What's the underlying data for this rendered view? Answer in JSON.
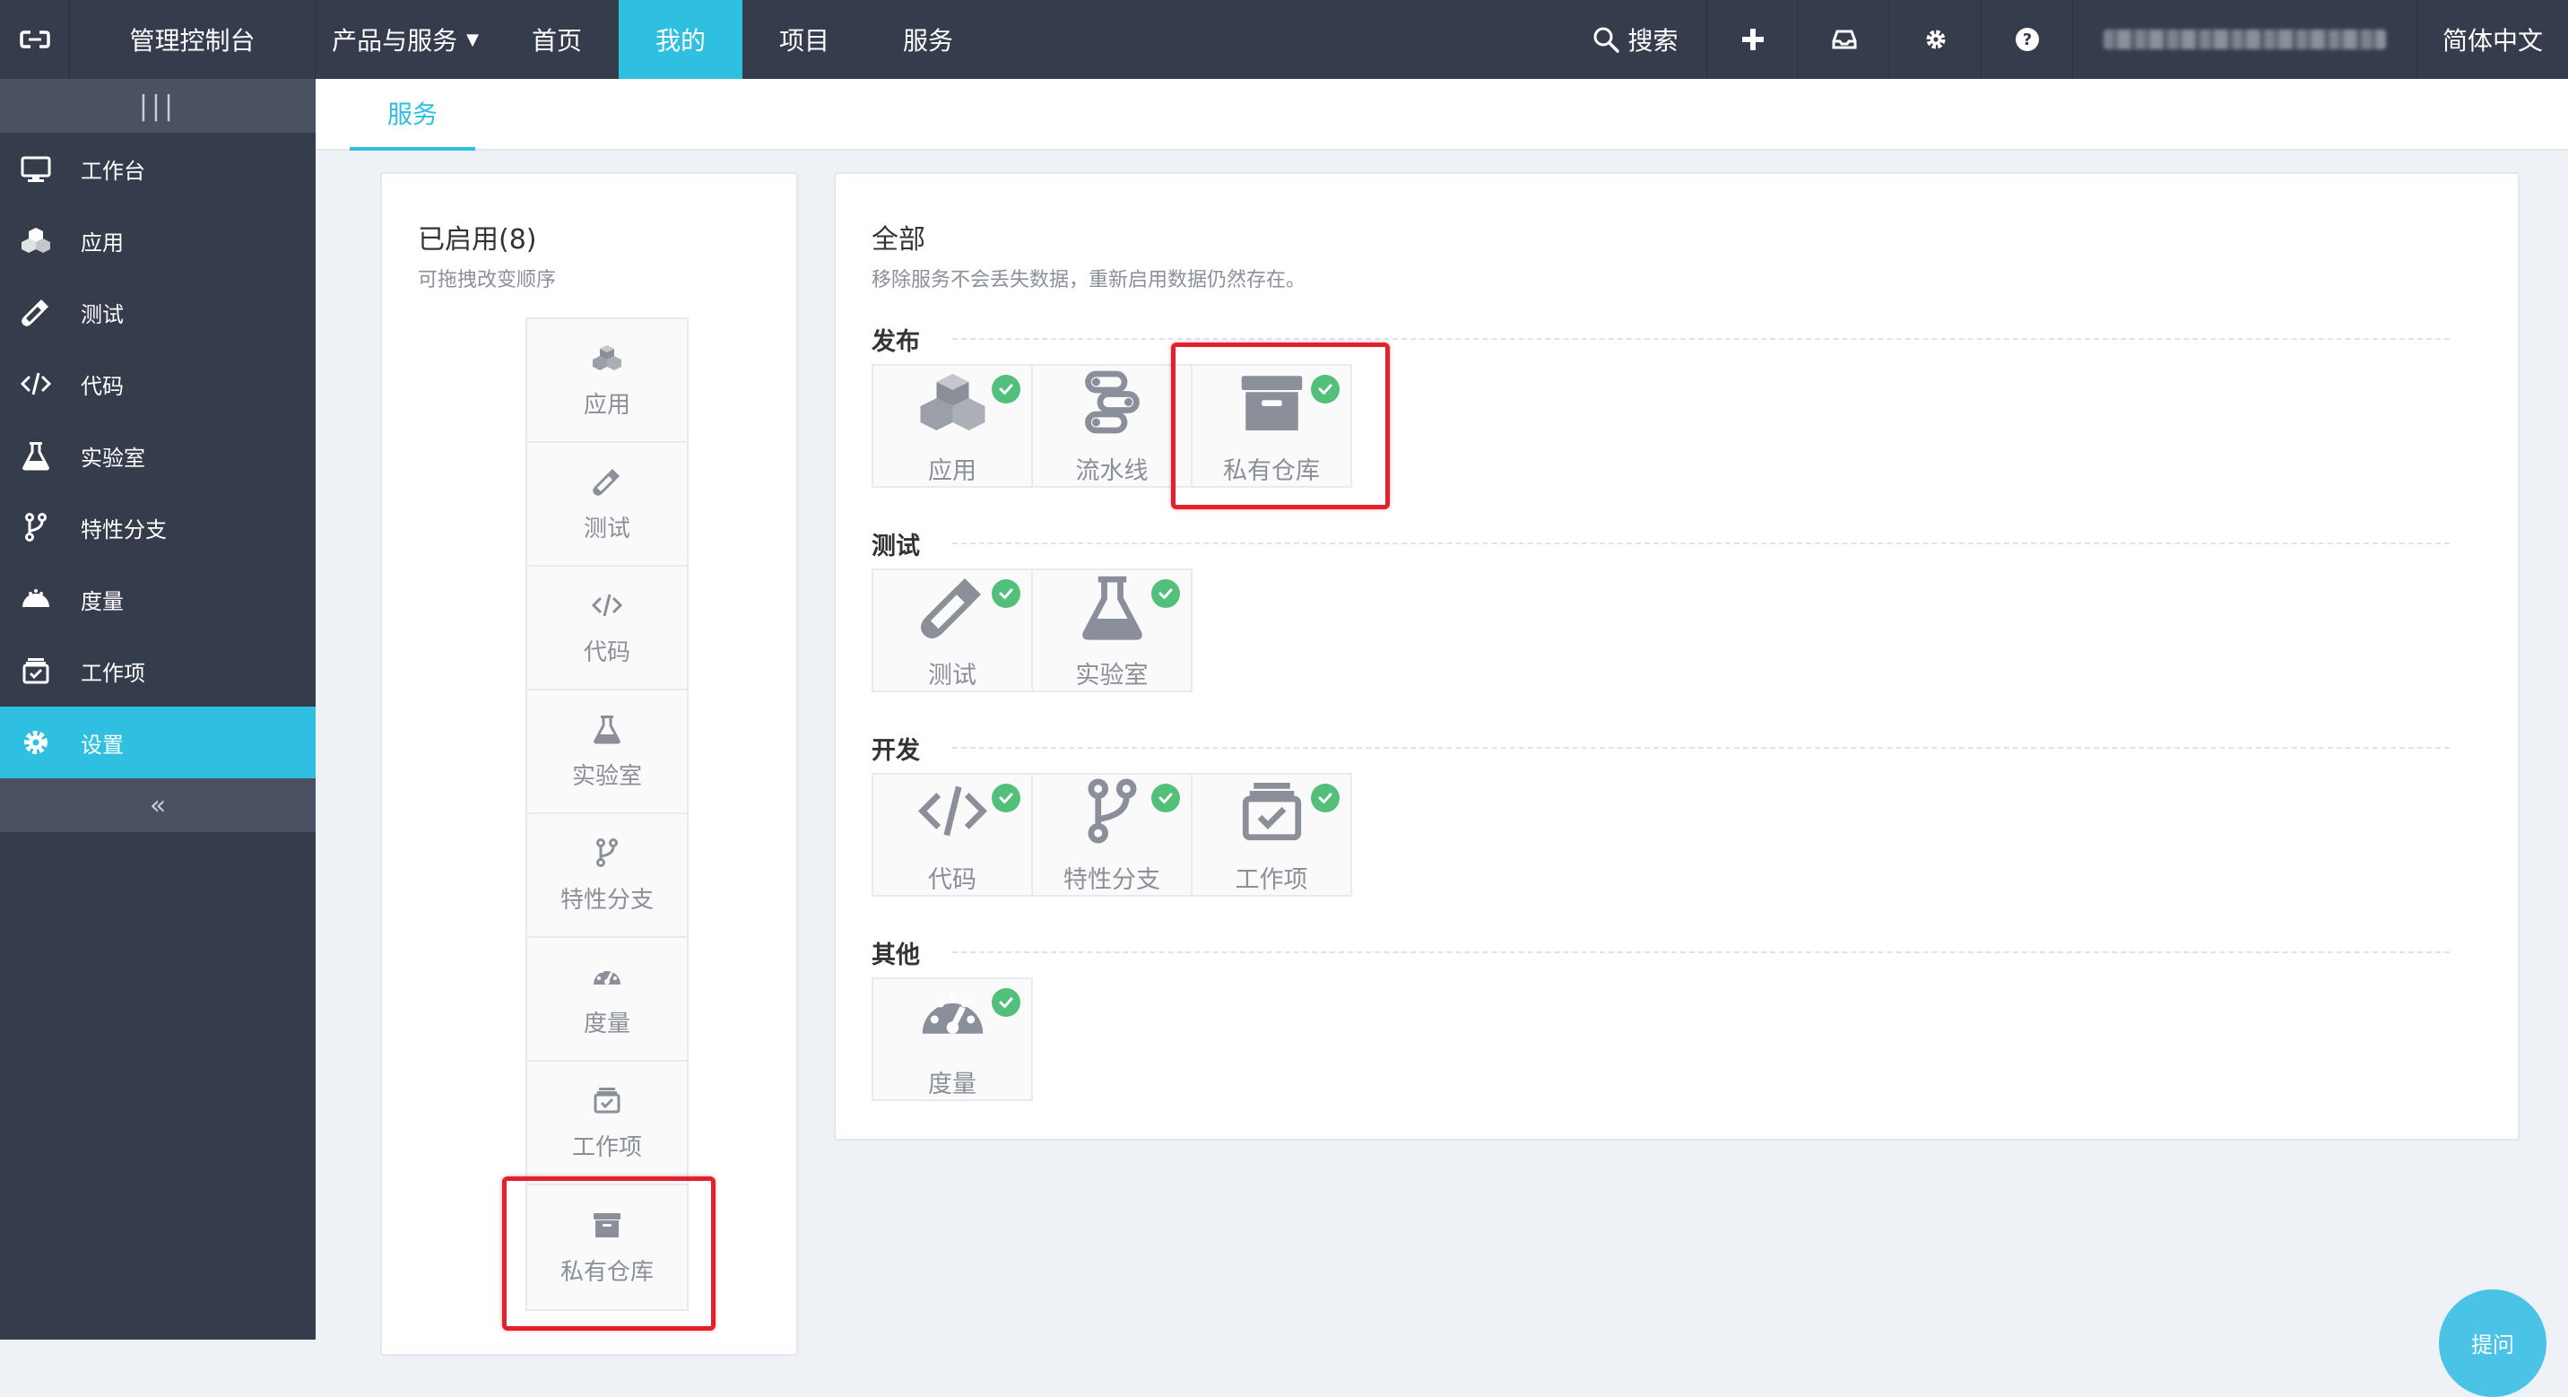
{
  "topbar": {
    "console": "管理控制台",
    "products": "产品与服务",
    "nav": [
      {
        "label": "首页"
      },
      {
        "label": "我的"
      },
      {
        "label": "项目"
      },
      {
        "label": "服务"
      }
    ],
    "search": "搜索",
    "lang": "简体中文"
  },
  "sidebar": {
    "items": [
      {
        "label": "工作台",
        "icon": "monitor-icon"
      },
      {
        "label": "应用",
        "icon": "cubes-icon"
      },
      {
        "label": "测试",
        "icon": "dropper-icon"
      },
      {
        "label": "代码",
        "icon": "code-icon"
      },
      {
        "label": "实验室",
        "icon": "flask-icon"
      },
      {
        "label": "特性分支",
        "icon": "branch-icon"
      },
      {
        "label": "度量",
        "icon": "gauge-icon"
      },
      {
        "label": "工作项",
        "icon": "workitem-icon"
      },
      {
        "label": "设置",
        "icon": "gear-icon",
        "active": true
      }
    ]
  },
  "subheader": {
    "tab": "服务"
  },
  "enabled": {
    "title": "已启用(8)",
    "desc": "可拖拽改变顺序",
    "items": [
      {
        "label": "应用",
        "icon": "cubes-icon"
      },
      {
        "label": "测试",
        "icon": "dropper-icon"
      },
      {
        "label": "代码",
        "icon": "code-icon"
      },
      {
        "label": "实验室",
        "icon": "flask-icon"
      },
      {
        "label": "特性分支",
        "icon": "branch-icon"
      },
      {
        "label": "度量",
        "icon": "gauge-icon"
      },
      {
        "label": "工作项",
        "icon": "workitem-icon"
      },
      {
        "label": "私有仓库",
        "icon": "archive-icon"
      }
    ]
  },
  "all": {
    "title": "全部",
    "desc": "移除服务不会丢失数据，重新启用数据仍然存在。",
    "categories": [
      {
        "title": "发布",
        "cards": [
          {
            "label": "应用",
            "icon": "cubes-icon",
            "enabled": true
          },
          {
            "label": "流水线",
            "icon": "pipeline-icon",
            "enabled": false
          },
          {
            "label": "私有仓库",
            "icon": "archive-icon",
            "enabled": true
          }
        ]
      },
      {
        "title": "测试",
        "cards": [
          {
            "label": "测试",
            "icon": "dropper-icon",
            "enabled": true
          },
          {
            "label": "实验室",
            "icon": "flask-icon",
            "enabled": true
          }
        ]
      },
      {
        "title": "开发",
        "cards": [
          {
            "label": "代码",
            "icon": "code-icon",
            "enabled": true
          },
          {
            "label": "特性分支",
            "icon": "branch-icon",
            "enabled": true
          },
          {
            "label": "工作项",
            "icon": "workitem-icon",
            "enabled": true
          }
        ]
      },
      {
        "title": "其他",
        "cards": [
          {
            "label": "度量",
            "icon": "gauge-icon",
            "enabled": true
          }
        ]
      }
    ]
  },
  "fab": {
    "label": "提问"
  },
  "colors": {
    "accent": "#2fbfe1",
    "topbar": "#353c4b",
    "check": "#52c07a",
    "annotation": "#e3212e"
  }
}
